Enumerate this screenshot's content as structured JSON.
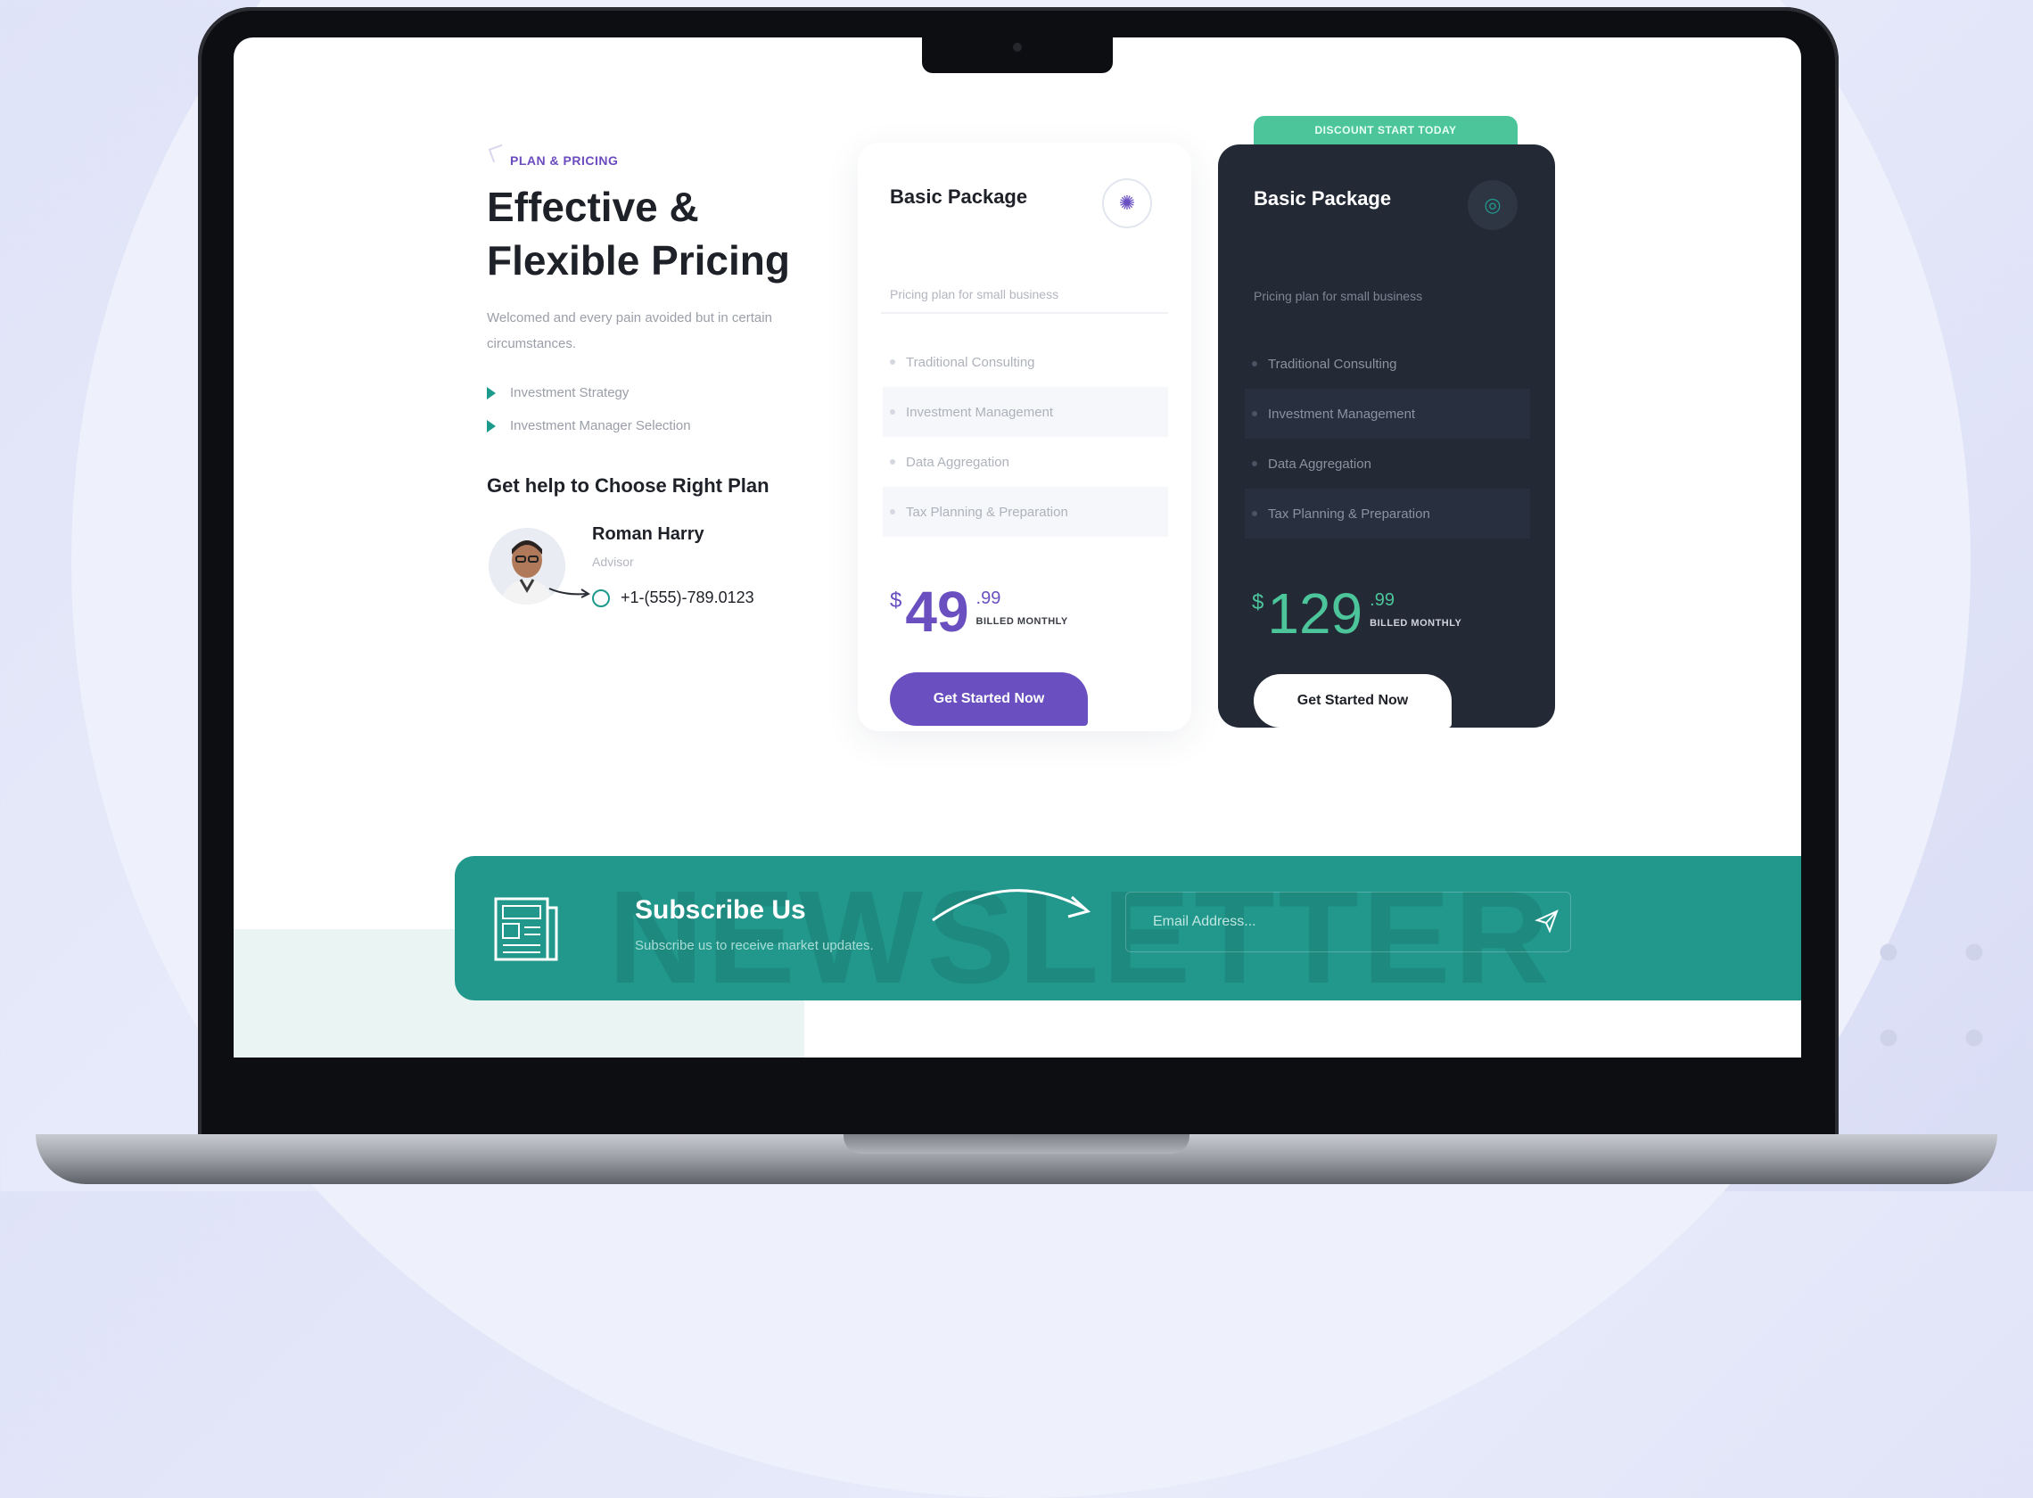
{
  "pricing": {
    "eyebrow": "PLAN & PRICING",
    "headline": "Effective & Flexible Pricing",
    "lead": "Welcomed and every pain avoided but in certain circumstances.",
    "bullets": [
      "Investment Strategy",
      "Investment Manager Selection"
    ],
    "help_title": "Get help to Choose Right Plan",
    "advisor": {
      "name": "Roman Harry",
      "role": "Advisor",
      "phone": "+1-(555)-789.0123"
    }
  },
  "plans": [
    {
      "title": "Basic Package",
      "subtitle": "Pricing plan for small business",
      "features": [
        "Traditional Consulting",
        "Investment Management",
        "Data Aggregation",
        "Tax Planning & Preparation"
      ],
      "currency": "$",
      "amount": "49",
      "cents": ".99",
      "billed": "BILLED MONTHLY",
      "button": "Get Started Now",
      "icon": "lightbulb-icon"
    },
    {
      "badge": "DISCOUNT START TODAY",
      "title": "Basic Package",
      "subtitle": "Pricing plan for small business",
      "features": [
        "Traditional Consulting",
        "Investment Management",
        "Data Aggregation",
        "Tax Planning & Preparation"
      ],
      "currency": "$",
      "amount": "129",
      "cents": ".99",
      "billed": "BILLED MONTHLY",
      "button": "Get Started Now",
      "icon": "target-icon"
    }
  ],
  "newsletter": {
    "title": "Subscribe Us",
    "subtitle": "Subscribe us to receive market updates.",
    "email_placeholder": "Email Address...",
    "bg_word": "NEWSLETTER",
    "icon": "news-icon"
  },
  "colors": {
    "accent_purple": "#6a4fc0",
    "teal": "#22988d",
    "green_badge": "#4cc59b",
    "dark_card": "#232a36"
  }
}
